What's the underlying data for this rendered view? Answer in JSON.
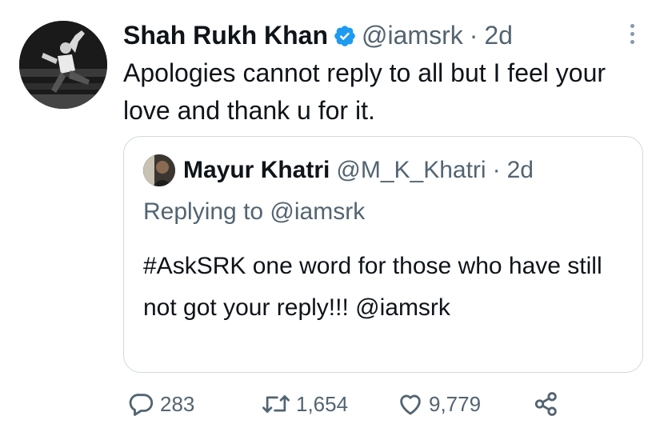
{
  "tweet": {
    "author_name": "Shah Rukh Khan",
    "author_handle": "@iamsrk",
    "separator": "·",
    "time": "2d",
    "text": "Apologies cannot reply to all but I feel your love and thank u for it."
  },
  "quoted": {
    "author_name": "Mayur Khatri",
    "author_handle": "@M_K_Khatri",
    "separator": "·",
    "time": "2d",
    "replying_to": "Replying to @iamsrk",
    "text": "#AskSRK one word for those who have still not got your reply!!! @iamsrk"
  },
  "actions": {
    "replies": "283",
    "retweets": "1,654",
    "likes": "9,779"
  },
  "icons": {
    "verified": "verified-badge-icon",
    "more": "more-vertical-icon",
    "reply": "reply-bubble-icon",
    "retweet": "retweet-icon",
    "like": "heart-icon",
    "share": "share-icon"
  },
  "colors": {
    "text": "#0f1419",
    "secondary": "#536471",
    "verified": "#1d9bf0",
    "border": "#cfd9de"
  }
}
